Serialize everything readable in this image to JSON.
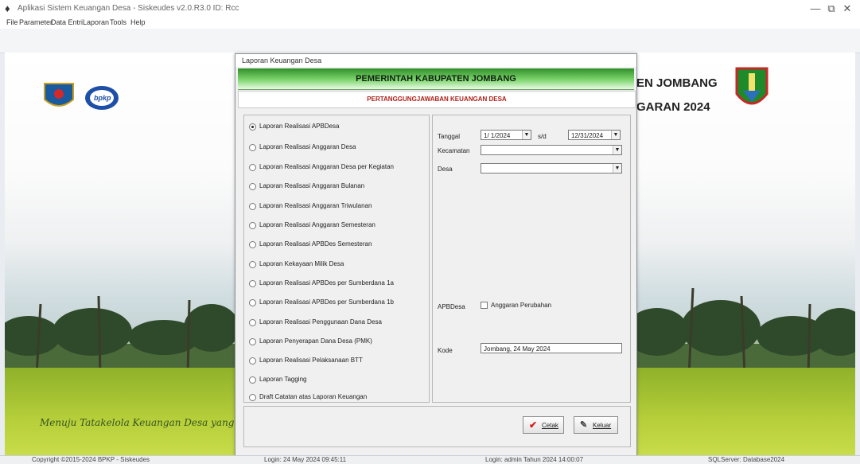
{
  "window": {
    "title": "Aplikasi Sistem Keuangan Desa - Siskeudes v2.0.R3.0 ID: Rcc",
    "controls": [
      "—",
      "⧉",
      "✕"
    ]
  },
  "menu": [
    "File",
    "Parameter",
    "Data Entri",
    "Laporan",
    "Tools",
    "Help"
  ],
  "background": {
    "heading_line1": "EN JOMBANG",
    "heading_line2": "GARAN 2024",
    "tagline": "Menuju Tatakelola Keuangan Desa yang Al",
    "bpkp_logo_text": "bpkp"
  },
  "dialog": {
    "title": "Laporan Keuangan Desa",
    "banner": "PEMERINTAH KABUPATEN JOMBANG",
    "subbanner": "PERTANGGUNGJAWABAN KEUANGAN DESA",
    "report_options": [
      "Laporan Realisasi APBDesa",
      "Laporan Realisasi Anggaran Desa",
      "Laporan Realisasi Anggaran Desa per Kegiatan",
      "Laporan Realisasi Anggaran Bulanan",
      "Laporan Realisasi Anggaran Triwulanan",
      "Laporan Realisasi Anggaran Semesteran",
      "Laporan Realisasi APBDes Semesteran",
      "Laporan Kekayaan Milik Desa",
      "Laporan Realisasi APBDes per Sumberdana 1a",
      "Laporan Realisasi APBDes per Sumberdana 1b",
      "Laporan Realisasi Penggunaan Dana Desa",
      "Laporan Penyerapan Dana Desa (PMK)",
      "Laporan Realisasi Pelaksanaan BTT",
      "Laporan Tagging",
      "Draft Catatan atas Laporan Keuangan"
    ],
    "selected_option": "Laporan Realisasi APBDesa",
    "tanggal_label": "Tanggal",
    "date_from": "1/ 1/2024",
    "sd_label": "s/d",
    "date_to": "12/31/2024",
    "kecamatan_label": "Kecamatan",
    "kecamatan_value": "",
    "desa_label": "Desa",
    "desa_value": "",
    "apbdesa_label": "APBDesa",
    "anggaran_perubahan_label": "Anggaran Perubahan",
    "kode_label": "Kode",
    "kode_value": "Jombang, 24 May 2024",
    "cetak_label": "Cetak",
    "keluar_label": "Keluar"
  },
  "statusbar": {
    "copyright": "Copyright ©2015-2024 BPKP - Siskeudes",
    "login_time": "Login: 24 May 2024 09:45:11",
    "user": "Login: admin  Tahun 2024  14:00:07",
    "db": "SQLServer: Database2024"
  },
  "colors": {
    "banner_green": "#2f8f2a",
    "subbanner_red": "#b0211a",
    "cetak_check": "#d21f1f"
  }
}
